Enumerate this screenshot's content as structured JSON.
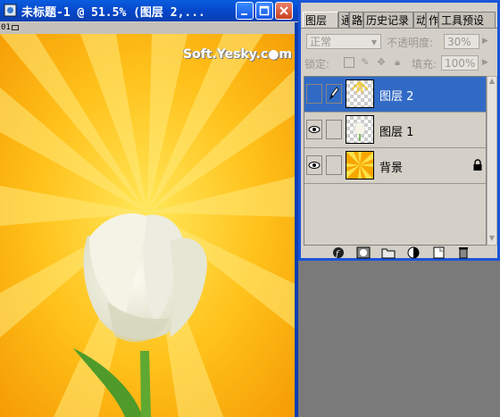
{
  "document": {
    "title": "未标题-1 @ 51.5% (图层 2,...",
    "ruler_tag": "01",
    "controls": {
      "minimize": "minimize",
      "maximize": "maximize",
      "close": "close"
    }
  },
  "watermark": "Soft.Yesky.c●m",
  "palette": {
    "tabs": [
      "图层",
      "通",
      "路",
      "历史记录",
      "动",
      "作",
      "工具预设"
    ],
    "blend_mode": "正常",
    "opacity_label": "不透明度:",
    "opacity_value": "30%",
    "lock_label": "锁定:",
    "fill_label": "填充:",
    "fill_value": "100%",
    "layers": [
      {
        "name": "图层 2",
        "selected": true,
        "visible": false,
        "linked": true
      },
      {
        "name": "图层 1",
        "selected": false,
        "visible": true,
        "linked": false
      },
      {
        "name": "背景",
        "selected": false,
        "visible": true,
        "linked": false,
        "locked": true
      }
    ]
  },
  "colors": {
    "title_bar": "#0646c8",
    "selection": "#316ac5",
    "canvas_orange": "#f7a600",
    "canvas_yellow": "#ffe14a"
  }
}
